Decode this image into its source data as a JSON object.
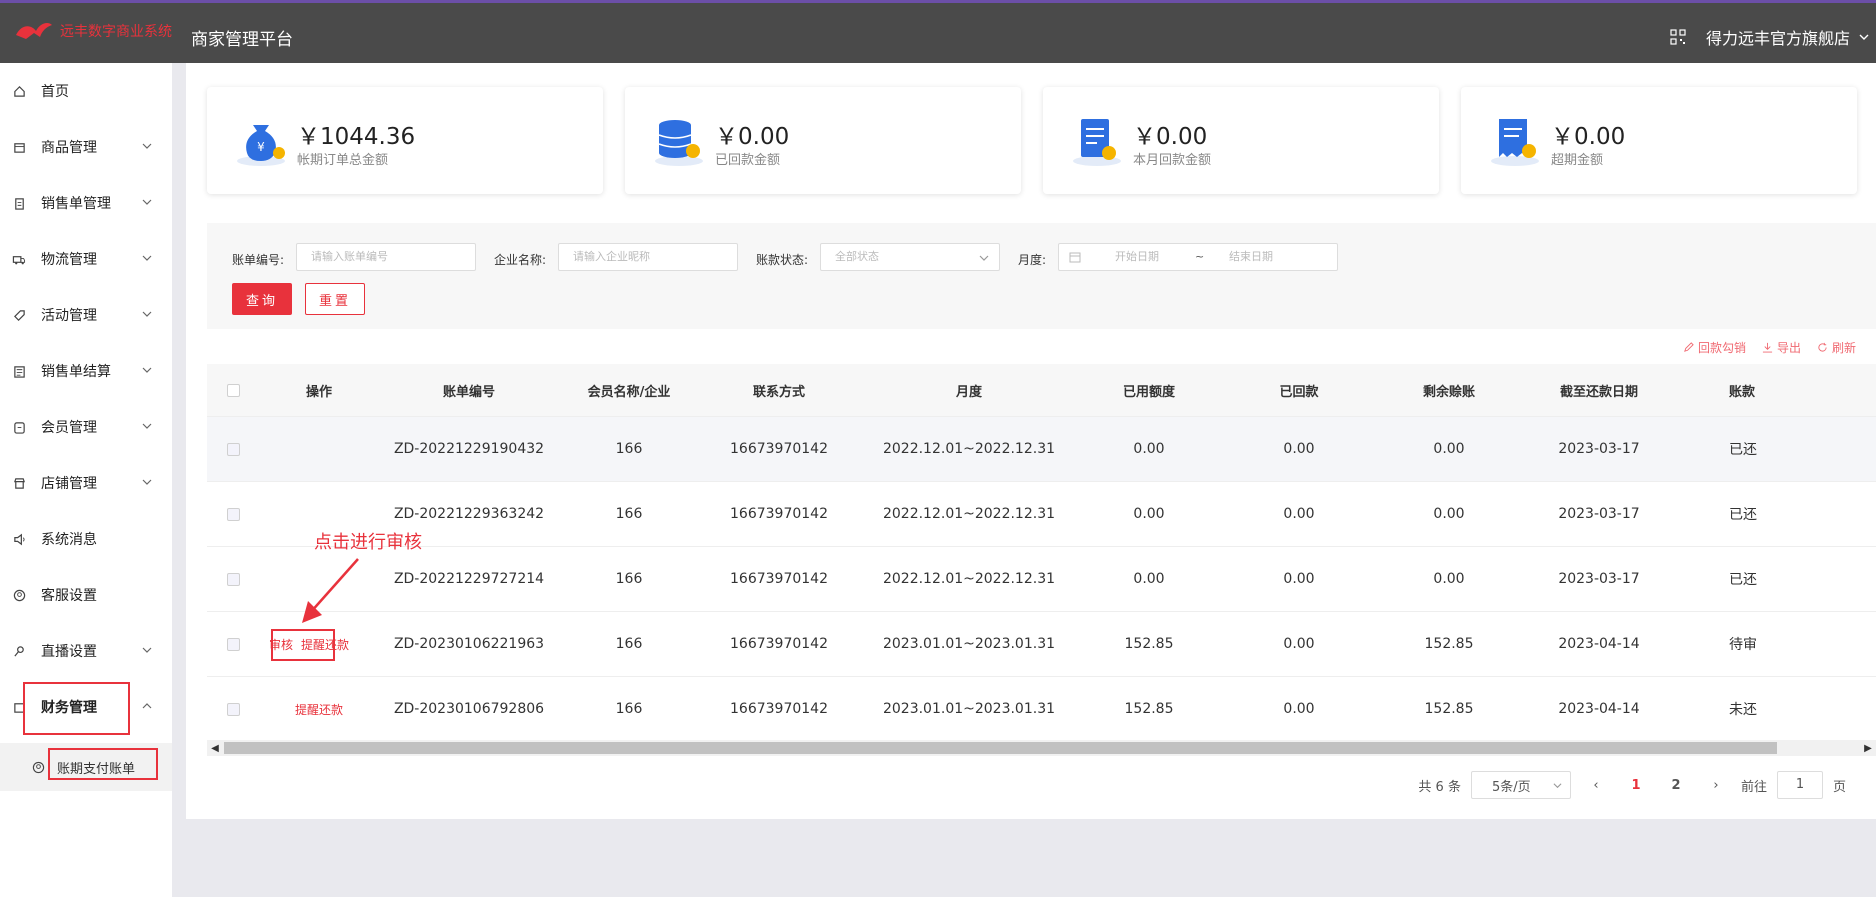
{
  "header": {
    "logo_text": "远丰数字商业系统",
    "platform_title": "商家管理平台",
    "store_name": "得力远丰官方旗舰店"
  },
  "sidebar": {
    "items": [
      {
        "label": "首页",
        "icon": "home-icon",
        "expandable": false
      },
      {
        "label": "商品管理",
        "icon": "box-icon",
        "expandable": true
      },
      {
        "label": "销售单管理",
        "icon": "clipboard-icon",
        "expandable": true
      },
      {
        "label": "物流管理",
        "icon": "truck-icon",
        "expandable": true
      },
      {
        "label": "活动管理",
        "icon": "tag-icon",
        "expandable": true
      },
      {
        "label": "销售单结算",
        "icon": "document-icon",
        "expandable": true
      },
      {
        "label": "会员管理",
        "icon": "member-icon",
        "expandable": true
      },
      {
        "label": "店铺管理",
        "icon": "shop-icon",
        "expandable": true
      },
      {
        "label": "系统消息",
        "icon": "speaker-icon",
        "expandable": false
      },
      {
        "label": "客服设置",
        "icon": "service-icon",
        "expandable": false
      },
      {
        "label": "直播设置",
        "icon": "key-icon",
        "expandable": true
      },
      {
        "label": "财务管理",
        "icon": "wallet-icon",
        "expandable": true,
        "expanded": true
      }
    ],
    "submenu": {
      "label": "账期支付账单",
      "icon": "user-circle-icon"
    }
  },
  "summary_cards": [
    {
      "amount": "￥1044.36",
      "label": "帐期订单总金额",
      "icon": "money-bag-icon"
    },
    {
      "amount": "￥0.00",
      "label": "已回款金额",
      "icon": "database-coins-icon"
    },
    {
      "amount": "￥0.00",
      "label": "本月回款金额",
      "icon": "invoice-icon"
    },
    {
      "amount": "￥0.00",
      "label": "超期金额",
      "icon": "overdue-receipt-icon"
    }
  ],
  "filters": {
    "bill_no_label": "账单编号:",
    "bill_no_placeholder": "请输入账单编号",
    "company_label": "企业名称:",
    "company_placeholder": "请输入企业昵称",
    "status_label": "账款状态:",
    "status_value": "全部状态",
    "month_label": "月度:",
    "start_placeholder": "开始日期",
    "range_sep": "~",
    "end_placeholder": "结束日期",
    "query_button": "查询",
    "reset_button": "重置"
  },
  "toolbar": {
    "reconcile": "回款勾销",
    "export": "导出",
    "refresh": "刷新"
  },
  "table": {
    "headers": [
      "操作",
      "账单编号",
      "会员名称/企业",
      "联系方式",
      "月度",
      "已用额度",
      "已回款",
      "剩余赊账",
      "截至还款日期",
      "账款"
    ],
    "rows": [
      {
        "actions": [],
        "bill_no": "ZD-20221229190432",
        "member": "166",
        "contact": "16673970142",
        "month": "2022.12.01~2022.12.31",
        "used": "0.00",
        "repaid": "0.00",
        "remaining": "0.00",
        "due_date": "2023-03-17",
        "status": "已还"
      },
      {
        "actions": [],
        "bill_no": "ZD-20221229363242",
        "member": "166",
        "contact": "16673970142",
        "month": "2022.12.01~2022.12.31",
        "used": "0.00",
        "repaid": "0.00",
        "remaining": "0.00",
        "due_date": "2023-03-17",
        "status": "已还"
      },
      {
        "actions": [],
        "bill_no": "ZD-20221229727214",
        "member": "166",
        "contact": "16673970142",
        "month": "2022.12.01~2022.12.31",
        "used": "0.00",
        "repaid": "0.00",
        "remaining": "0.00",
        "due_date": "2023-03-17",
        "status": "已还"
      },
      {
        "actions": [
          "审核",
          "提醒还款"
        ],
        "bill_no": "ZD-20230106221963",
        "member": "166",
        "contact": "16673970142",
        "month": "2023.01.01~2023.01.31",
        "used": "152.85",
        "repaid": "0.00",
        "remaining": "152.85",
        "due_date": "2023-04-14",
        "status": "待审"
      },
      {
        "actions": [
          "提醒还款"
        ],
        "bill_no": "ZD-20230106792806",
        "member": "166",
        "contact": "16673970142",
        "month": "2023.01.01~2023.01.31",
        "used": "152.85",
        "repaid": "0.00",
        "remaining": "152.85",
        "due_date": "2023-04-14",
        "status": "未还"
      }
    ]
  },
  "pagination": {
    "total": "共 6 条",
    "page_size": "5条/页",
    "pages": [
      "1",
      "2"
    ],
    "current_page": "1",
    "goto_label": "前往",
    "goto_value": "1",
    "page_unit": "页"
  },
  "annotation": {
    "text": "点击进行审核"
  },
  "colors": {
    "accent": "#e8323c",
    "topbar": "#4a4a4a"
  }
}
